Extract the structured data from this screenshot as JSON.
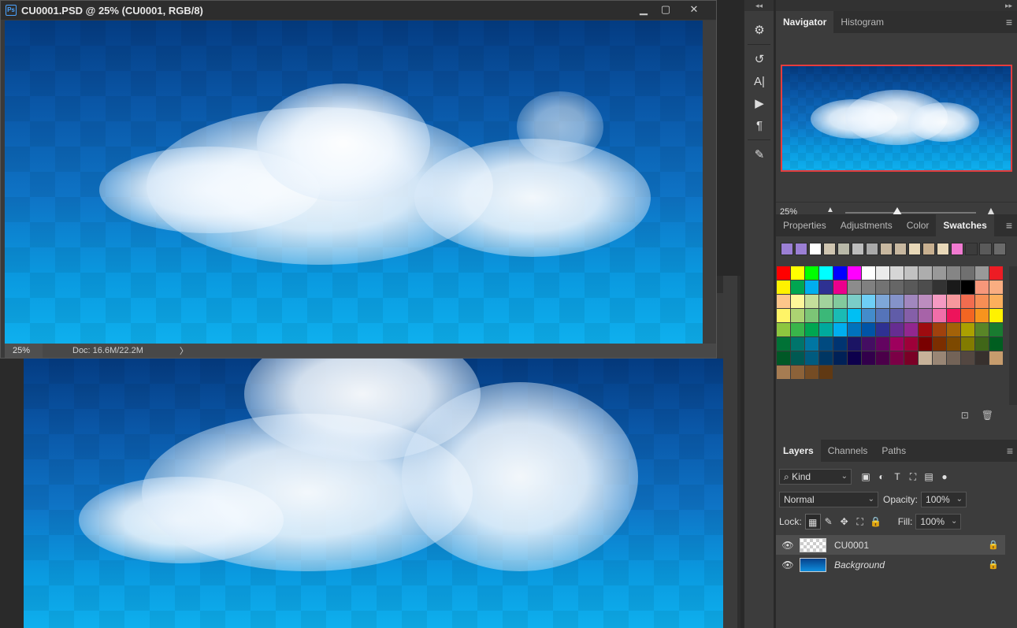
{
  "document": {
    "title": "CU0001.PSD @ 25% (CU0001, RGB/8)",
    "ps_badge": "Ps",
    "window_controls": {
      "minimize": "▁",
      "maximize": "▢",
      "close": "✕"
    },
    "status_zoom": "25%",
    "status_doc": "Doc: 16.6M/22.2M",
    "status_arrow": "〉"
  },
  "tools": {
    "collapse": "◂◂",
    "items": [
      {
        "name": "sliders",
        "glyph": "⚙"
      },
      {
        "name": "history",
        "glyph": "↺"
      },
      {
        "name": "character",
        "glyph": "A|"
      },
      {
        "name": "play",
        "glyph": "▶"
      },
      {
        "name": "paragraph",
        "glyph": "¶"
      },
      {
        "name": "brush-settings",
        "glyph": "✎"
      }
    ]
  },
  "navigator": {
    "collapse": "▸▸",
    "tabs": [
      "Navigator",
      "Histogram"
    ],
    "active_tab": "Navigator",
    "zoom_value": "25%",
    "zoom_slider_pct": 40,
    "menu_glyph": "≡"
  },
  "swatches_panel": {
    "tabs": [
      "Properties",
      "Adjustments",
      "Color",
      "Swatches"
    ],
    "active_tab": "Swatches",
    "recent": [
      "#9b7fd4",
      "#9b7fd4",
      "#ffffff",
      "#cfc5b0",
      "#b8b8a8",
      "#bcbcbc",
      "#a9a9a9",
      "#c8b8a0",
      "#c8b8a0",
      "#e8d8b8",
      "#c8b090",
      "#e8d8b8",
      "#f07ad0",
      "#3c3c3c",
      "#5a5a5a",
      "#6a6a6a"
    ],
    "grid": [
      "#ff0000",
      "#ffff00",
      "#00ff00",
      "#00ffff",
      "#0000ff",
      "#ff00ff",
      "#ffffff",
      "#ebebeb",
      "#d6d6d6",
      "#c2c2c2",
      "#adadad",
      "#999999",
      "#858585",
      "#707070",
      "#999999",
      "#ed1c24",
      "#fff200",
      "#00a651",
      "#00aeef",
      "#2e3192",
      "#ec008c",
      "#8c8c8c",
      "#808080",
      "#737373",
      "#666666",
      "#595959",
      "#4d4d4d",
      "#333333",
      "#1a1a1a",
      "#000000",
      "#f7977a",
      "#f9ad81",
      "#fdc68a",
      "#fff79a",
      "#c4df9b",
      "#a2d39c",
      "#82ca9d",
      "#7bcdc8",
      "#6ecff6",
      "#7ea7d8",
      "#8493ca",
      "#a187be",
      "#bc8dbf",
      "#f49ac2",
      "#f6989d",
      "#f26c4f",
      "#f68e55",
      "#fbaf5c",
      "#fff467",
      "#acd372",
      "#7cc576",
      "#3bb878",
      "#1abbb4",
      "#00bff3",
      "#438ccb",
      "#5574b9",
      "#605ca8",
      "#855fa8",
      "#a763a8",
      "#f06ea9",
      "#ed145b",
      "#f26522",
      "#f7941d",
      "#fff200",
      "#8dc63f",
      "#39b54a",
      "#00a651",
      "#00a99d",
      "#00aeef",
      "#0072bc",
      "#0054a6",
      "#2e3192",
      "#662d91",
      "#92278f",
      "#9e0b0f",
      "#a0410d",
      "#a36209",
      "#aba000",
      "#598527",
      "#197b30",
      "#007236",
      "#00746b",
      "#0076a3",
      "#004a80",
      "#003471",
      "#1b1464",
      "#440e62",
      "#630460",
      "#9e005d",
      "#9e0039",
      "#790000",
      "#7b2e00",
      "#7d4900",
      "#827b00",
      "#406618",
      "#005e20",
      "#005826",
      "#005952",
      "#005b7f",
      "#003663",
      "#002157",
      "#0d004c",
      "#32004b",
      "#4b0049",
      "#7b0046",
      "#7a0026",
      "#c7b299",
      "#998675",
      "#736357",
      "#534741",
      "#37302d",
      "#c69c6d",
      "#a67c52",
      "#8c6239",
      "#754c24",
      "#603913"
    ],
    "menu_glyph": "≡",
    "new_glyph": "⊡",
    "delete_glyph": "🗑"
  },
  "layers_panel": {
    "tabs": [
      "Layers",
      "Channels",
      "Paths"
    ],
    "active_tab": "Layers",
    "menu_glyph": "≡",
    "filter_label": "Kind",
    "filter_icons": [
      "image-filter",
      "adjustment-filter",
      "type-filter",
      "shape-filter",
      "smart-filter",
      "toggle-filter"
    ],
    "filter_glyphs": [
      "▣",
      "◐",
      "T",
      "⛶",
      "▤",
      "●"
    ],
    "blend_mode": "Normal",
    "opacity_label": "Opacity:",
    "opacity_value": "100%",
    "lock_label": "Lock:",
    "lock_glyphs": [
      "▦",
      "✎",
      "✥",
      "⛶",
      "🔒"
    ],
    "fill_label": "Fill:",
    "fill_value": "100%",
    "layers": [
      {
        "name": "CU0001",
        "visible": true,
        "locked": true,
        "selected": true,
        "italic": false,
        "thumb": "transparent"
      },
      {
        "name": "Background",
        "visible": true,
        "locked": true,
        "selected": false,
        "italic": true,
        "thumb": "background"
      }
    ],
    "eye_glyph": "👁",
    "lock_glyph": "🔒"
  }
}
